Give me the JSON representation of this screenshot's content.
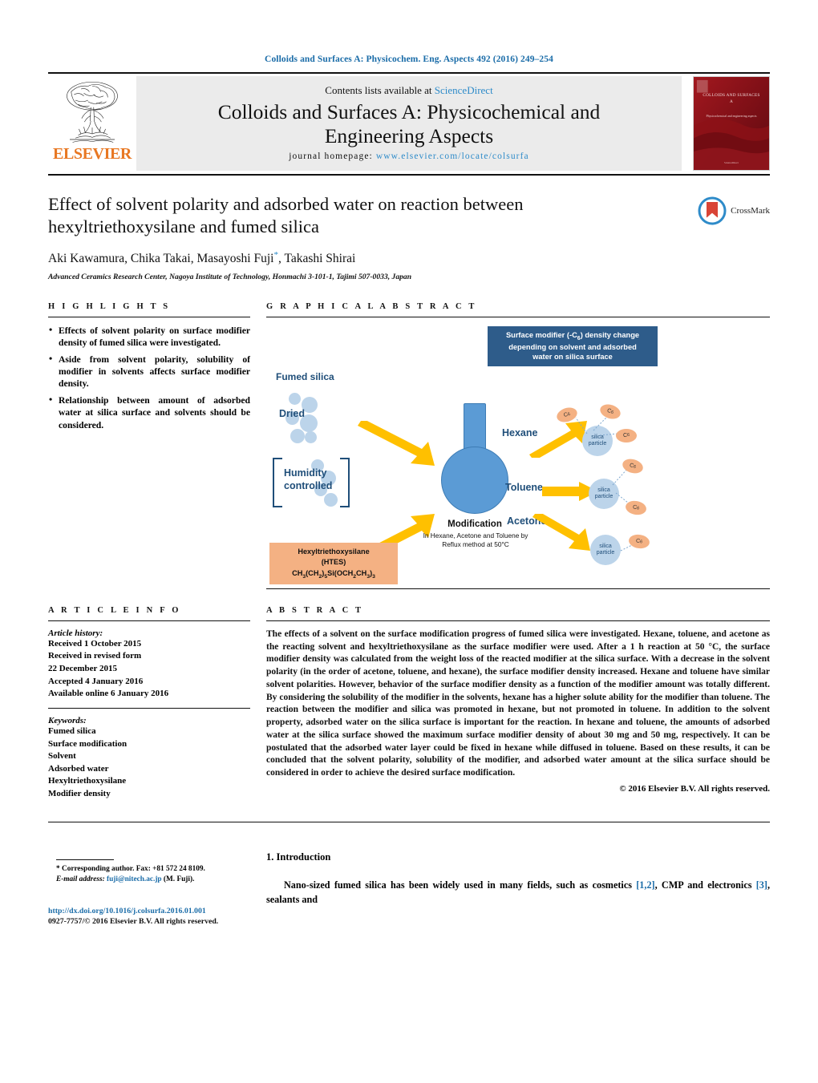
{
  "running_head": "Colloids and Surfaces A: Physicochem. Eng. Aspects 492 (2016) 249–254",
  "masthead": {
    "publisher": "ELSEVIER",
    "contents_prefix": "Contents lists available at",
    "contents_link": "ScienceDirect",
    "journal_title_line1": "Colloids and Surfaces A: Physicochemical and",
    "journal_title_line2": "Engineering Aspects",
    "homepage_label": "journal homepage:",
    "homepage_url": "www.elsevier.com/locate/colsurfa",
    "cover": {
      "title": "COLLOIDS AND SURFACES A",
      "subtitle": "Physicochemical and engineering aspects",
      "footer": "ScienceDirect"
    }
  },
  "article": {
    "title": "Effect of solvent polarity and adsorbed water on reaction between hexyltriethoxysilane and fumed silica",
    "authors": "Aki Kawamura, Chika Takai, Masayoshi Fuji",
    "authors_tail": ", Takashi Shirai",
    "corresponding_marker": "*",
    "affiliation": "Advanced Ceramics Research Center, Nagoya Institute of Technology, Honmachi 3-101-1, Tajimi 507-0033, Japan",
    "crossmark_label": "CrossMark"
  },
  "highlights": {
    "heading": "H I G H L I G H T S",
    "items": [
      "Effects of solvent polarity on surface modifier density of fumed silica were investigated.",
      "Aside from solvent polarity, solubility of modifier in solvents affects surface modifier density.",
      "Relationship between amount of adsorbed water at silica surface and solvents should be considered."
    ]
  },
  "graphical_abstract": {
    "heading": "G R A P H I C A L   A B S T R A C T",
    "banner_line1": "Surface modifier (-C",
    "banner_sub": "6",
    "banner_line1b": ") density change",
    "banner_line2": "depending on solvent and adsorbed",
    "banner_line3": "water on silica surface",
    "fumed_silica_label": "Fumed silica",
    "dried_label": "Dried",
    "humidity_label_1": "Humidity",
    "humidity_label_2": "controlled",
    "modification_title": "Modification",
    "modification_sub1": "In Hexane, Acetone and Toluene by",
    "modification_sub2": "Reflux method at 50°C",
    "hts_name": "Hexyltriethoxysilane",
    "hts_abbrev": "(HTES)",
    "hts_formula": "CH3(CH2)5Si(OCH2CH3)3",
    "solvents": [
      "Hexane",
      "Toluene",
      "Acetone"
    ],
    "particle_label_1": "silica",
    "particle_label_2": "particle",
    "modifier_label": "C6"
  },
  "article_info": {
    "heading": "A R T I C L E   I N F O",
    "history_label": "Article history:",
    "history": [
      "Received 1 October 2015",
      "Received in revised form",
      "22 December 2015",
      "Accepted 4 January 2016",
      "Available online 6 January 2016"
    ],
    "keywords_label": "Keywords:",
    "keywords": [
      "Fumed silica",
      "Surface modification",
      "Solvent",
      "Adsorbed water",
      "Hexyltriethoxysilane",
      "Modifier density"
    ]
  },
  "abstract": {
    "heading": "A B S T R A C T",
    "body": "The effects of a solvent on the surface modification progress of fumed silica were investigated. Hexane, toluene, and acetone as the reacting solvent and hexyltriethoxysilane as the surface modifier were used. After a 1 h reaction at 50 °C, the surface modifier density was calculated from the weight loss of the reacted modifier at the silica surface. With a decrease in the solvent polarity (in the order of acetone, toluene, and hexane), the surface modifier density increased. Hexane and toluene have similar solvent polarities. However, behavior of the surface modifier density as a function of the modifier amount was totally different. By considering the solubility of the modifier in the solvents, hexane has a higher solute ability for the modifier than toluene. The reaction between the modifier and silica was promoted in hexane, but not promoted in toluene. In addition to the solvent property, adsorbed water on the silica surface is important for the reaction. In hexane and toluene, the amounts of adsorbed water at the silica surface showed the maximum surface modifier density of about 30 mg and 50 mg, respectively. It can be postulated that the adsorbed water layer could be fixed in hexane while diffused in toluene. Based on these results, it can be concluded that the solvent polarity, solubility of the modifier, and adsorbed water amount at the silica surface should be considered in order to achieve the desired surface modification.",
    "copyright": "© 2016 Elsevier B.V. All rights reserved."
  },
  "footer": {
    "corresponding_note": "Corresponding author. Fax: +81 572 24 8109.",
    "email_label": "E-mail address:",
    "email": "fuji@nitech.ac.jp",
    "email_suffix": "(M. Fuji).",
    "doi": "http://dx.doi.org/10.1016/j.colsurfa.2016.01.001",
    "issn": "0927-7757/© 2016 Elsevier B.V. All rights reserved."
  },
  "introduction": {
    "heading": "1. Introduction",
    "para_start": "Nano-sized fumed silica has been widely used in many fields, such as cosmetics ",
    "ref1": "[1,2]",
    "para_mid": ", CMP and electronics ",
    "ref2": "[3]",
    "para_end": ", sealants and"
  },
  "colors": {
    "link": "#1a6ca8",
    "sciencedirect": "#2e8bc9",
    "elsevier_orange": "#E87722",
    "ga_blue": "#1F4E79",
    "ga_banner": "#2E5C8A",
    "ga_orange": "#F4B183",
    "ga_arrow": "#FFC000",
    "flask_blue": "#5B9BD5",
    "silica_blue": "#bcd4ea"
  }
}
